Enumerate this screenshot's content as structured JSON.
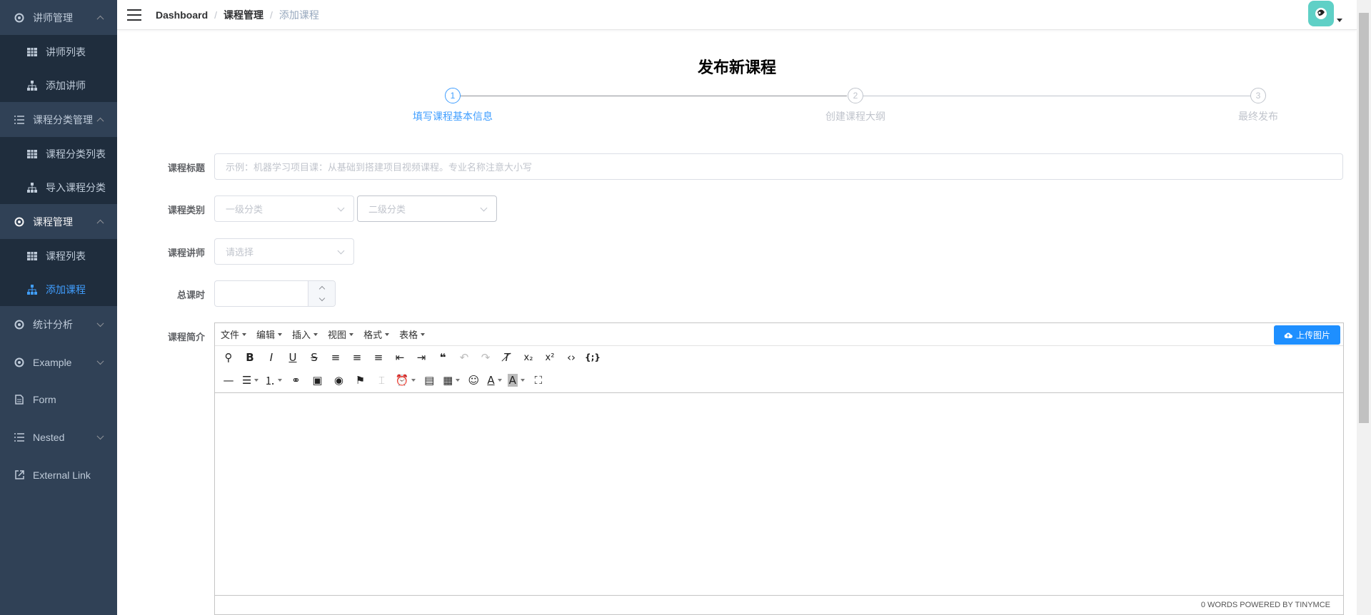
{
  "sidebar": {
    "menus": [
      {
        "label": "讲师管理",
        "icon": "setting-icon",
        "expanded": true,
        "items": [
          {
            "label": "讲师列表",
            "icon": "table-icon"
          },
          {
            "label": "添加讲师",
            "icon": "tree-icon"
          }
        ]
      },
      {
        "label": "课程分类管理",
        "icon": "list-icon",
        "expanded": true,
        "items": [
          {
            "label": "课程分类列表",
            "icon": "table-icon"
          },
          {
            "label": "导入课程分类",
            "icon": "tree-icon"
          }
        ]
      },
      {
        "label": "课程管理",
        "icon": "setting-icon",
        "expanded": true,
        "items": [
          {
            "label": "课程列表",
            "icon": "table-icon"
          },
          {
            "label": "添加课程",
            "icon": "tree-icon",
            "active": true
          }
        ]
      },
      {
        "label": "统计分析",
        "icon": "setting-icon",
        "expanded": false
      },
      {
        "label": "Example",
        "icon": "setting-icon",
        "expanded": false
      },
      {
        "label": "Form",
        "icon": "form-icon"
      },
      {
        "label": "Nested",
        "icon": "list-icon",
        "expanded": false
      },
      {
        "label": "External Link",
        "icon": "link-icon"
      }
    ]
  },
  "navbar": {
    "breadcrumb": [
      "Dashboard",
      "课程管理",
      "添加课程"
    ]
  },
  "page": {
    "title": "发布新课程"
  },
  "steps": [
    {
      "number": "1",
      "label": "填写课程基本信息",
      "active": true
    },
    {
      "number": "2",
      "label": "创建课程大纲",
      "active": false
    },
    {
      "number": "3",
      "label": "最终发布",
      "active": false
    }
  ],
  "form": {
    "title_label": "课程标题",
    "title_placeholder": "示例：机器学习项目课：从基础到搭建项目视频课程。专业名称注意大小写",
    "category_label": "课程类别",
    "category1_placeholder": "一级分类",
    "category2_placeholder": "二级分类",
    "teacher_label": "课程讲师",
    "teacher_placeholder": "请选择",
    "hours_label": "总课时",
    "hours_value": "",
    "desc_label": "课程简介"
  },
  "editor": {
    "menus": [
      "文件",
      "编辑",
      "插入",
      "视图",
      "格式",
      "表格"
    ],
    "upload_label": "上传图片",
    "status": "0 WORDS POWERED BY TINYMCE"
  },
  "colors": {
    "sidebar_bg": "#304156",
    "submenu_bg": "#1f2d3d",
    "accent": "#409eff",
    "upload_button": "#1e8fff"
  }
}
